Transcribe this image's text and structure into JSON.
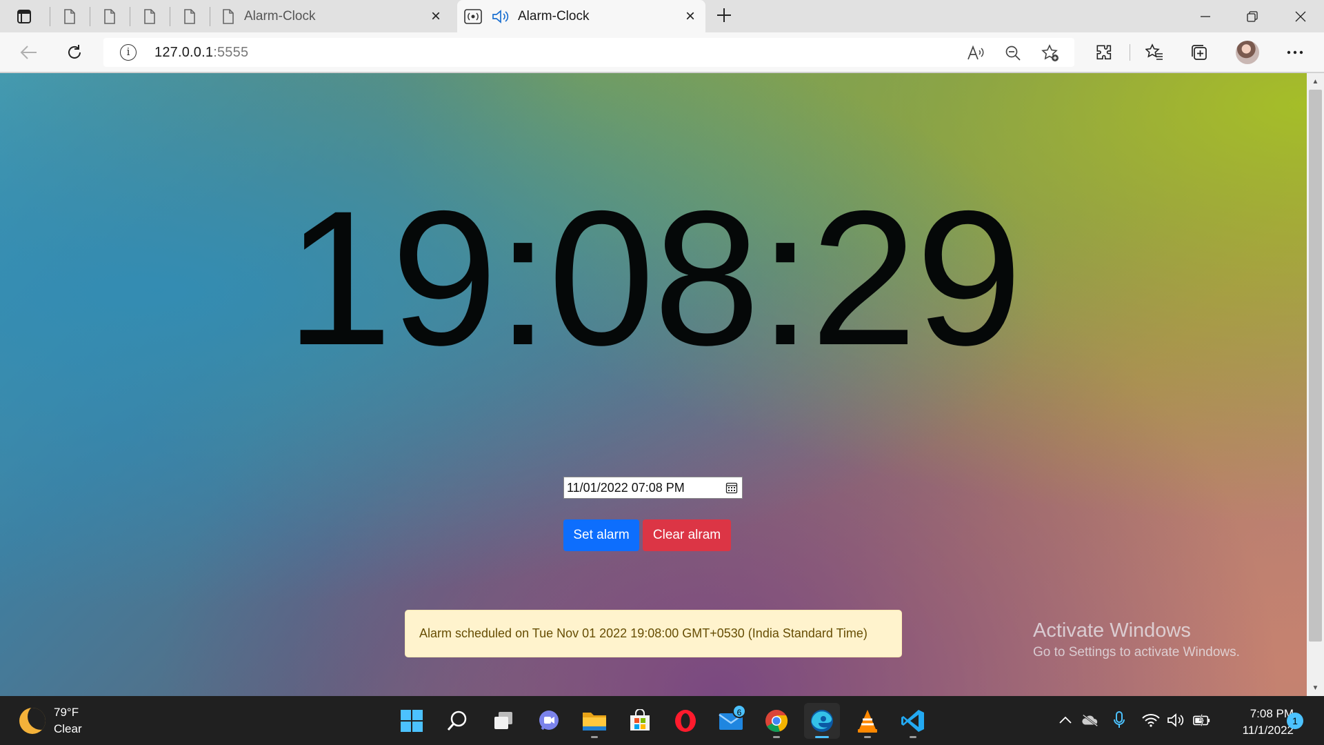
{
  "browser": {
    "tabs": [
      {
        "label": "",
        "active": false
      },
      {
        "label": "",
        "active": false
      },
      {
        "label": "",
        "active": false
      },
      {
        "label": "",
        "active": false
      },
      {
        "label": "Alarm-Clock",
        "active": false
      },
      {
        "label": "Alarm-Clock",
        "active": true
      }
    ],
    "url_host": "127.0.0.1",
    "url_port": ":5555",
    "icons": [
      "tab-actions-icon",
      "page-icon",
      "back-arrow-icon",
      "refresh-icon",
      "info-icon",
      "read-aloud-icon",
      "zoom-out-icon",
      "add-favorite-icon",
      "extensions-icon",
      "favorites-icon",
      "collections-icon",
      "more-icon",
      "audio-playing-icon",
      "close-icon",
      "plus-icon",
      "minimize-icon",
      "restore-icon"
    ]
  },
  "page": {
    "clock_time": "19:08:29",
    "datetime_value": "11/01/2022 07:08  PM",
    "set_label": "Set alarm",
    "clear_label": "Clear alram",
    "alert_text": "Alarm scheduled on Tue Nov 01 2022 19:08:00 GMT+0530 (India Standard Time)",
    "colors": {
      "set_button": "#0d6efd",
      "clear_button": "#dc3545",
      "alert_bg": "#fff3cd",
      "alert_text": "#664d03"
    }
  },
  "watermark": {
    "line1": "Activate Windows",
    "line2": "Go to Settings to activate Windows."
  },
  "taskbar": {
    "weather_temp": "79°F",
    "weather_desc": "Clear",
    "mail_badge": "6",
    "time": "7:08 PM",
    "date": "11/1/2022",
    "notifications": "1",
    "apps": [
      "start",
      "search",
      "task-view",
      "teams-chat",
      "file-explorer",
      "microsoft-store",
      "opera",
      "mail",
      "chrome",
      "edge",
      "vlc",
      "vscode"
    ]
  }
}
